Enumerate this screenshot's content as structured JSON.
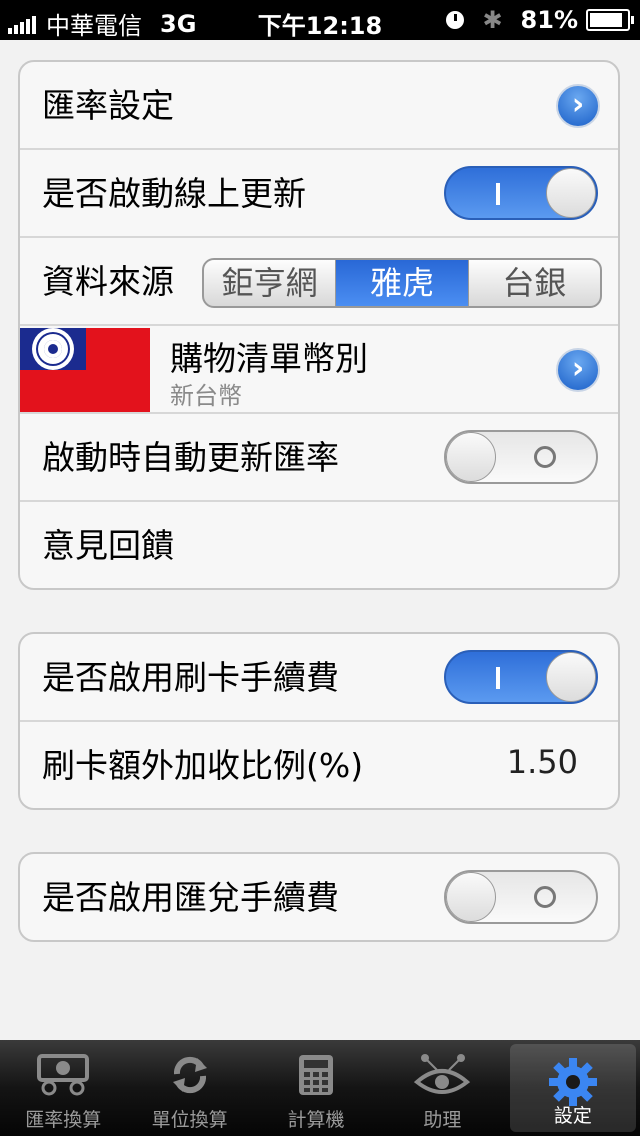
{
  "status_bar": {
    "carrier": "中華電信",
    "network": "3G",
    "time": "下午12:18",
    "battery": "81%",
    "battery_level": 0.81
  },
  "group1": {
    "exchange_rate_settings": "匯率設定",
    "online_update_label": "是否啟動線上更新",
    "online_update_on": true,
    "data_source_label": "資料來源",
    "data_source_options": [
      "鉅亨網",
      "雅虎",
      "台銀"
    ],
    "data_source_selected": "雅虎",
    "shopping_list_currency_title": "購物清單幣別",
    "shopping_list_currency_value": "新台幣",
    "auto_update_label": "啟動時自動更新匯率",
    "auto_update_on": false,
    "feedback_label": "意見回饋"
  },
  "group2": {
    "card_fee_label": "是否啟用刷卡手續費",
    "card_fee_on": true,
    "extra_percent_label": "刷卡額外加收比例(%)",
    "extra_percent_value": "1.50"
  },
  "group3": {
    "remit_fee_label": "是否啟用匯兌手續費",
    "remit_fee_on": false
  },
  "tab_bar": {
    "tabs": [
      {
        "label": "匯率換算",
        "icon": "currency-exchange-icon"
      },
      {
        "label": "單位換算",
        "icon": "refresh-icon"
      },
      {
        "label": "計算機",
        "icon": "calculator-icon"
      },
      {
        "label": "助理",
        "icon": "eye-network-icon"
      },
      {
        "label": "設定",
        "icon": "gear-icon"
      }
    ],
    "selected": "設定"
  },
  "colors": {
    "accent": "#2f6fd9",
    "flag_red": "#e3121c",
    "flag_blue": "#1b2b8f"
  }
}
